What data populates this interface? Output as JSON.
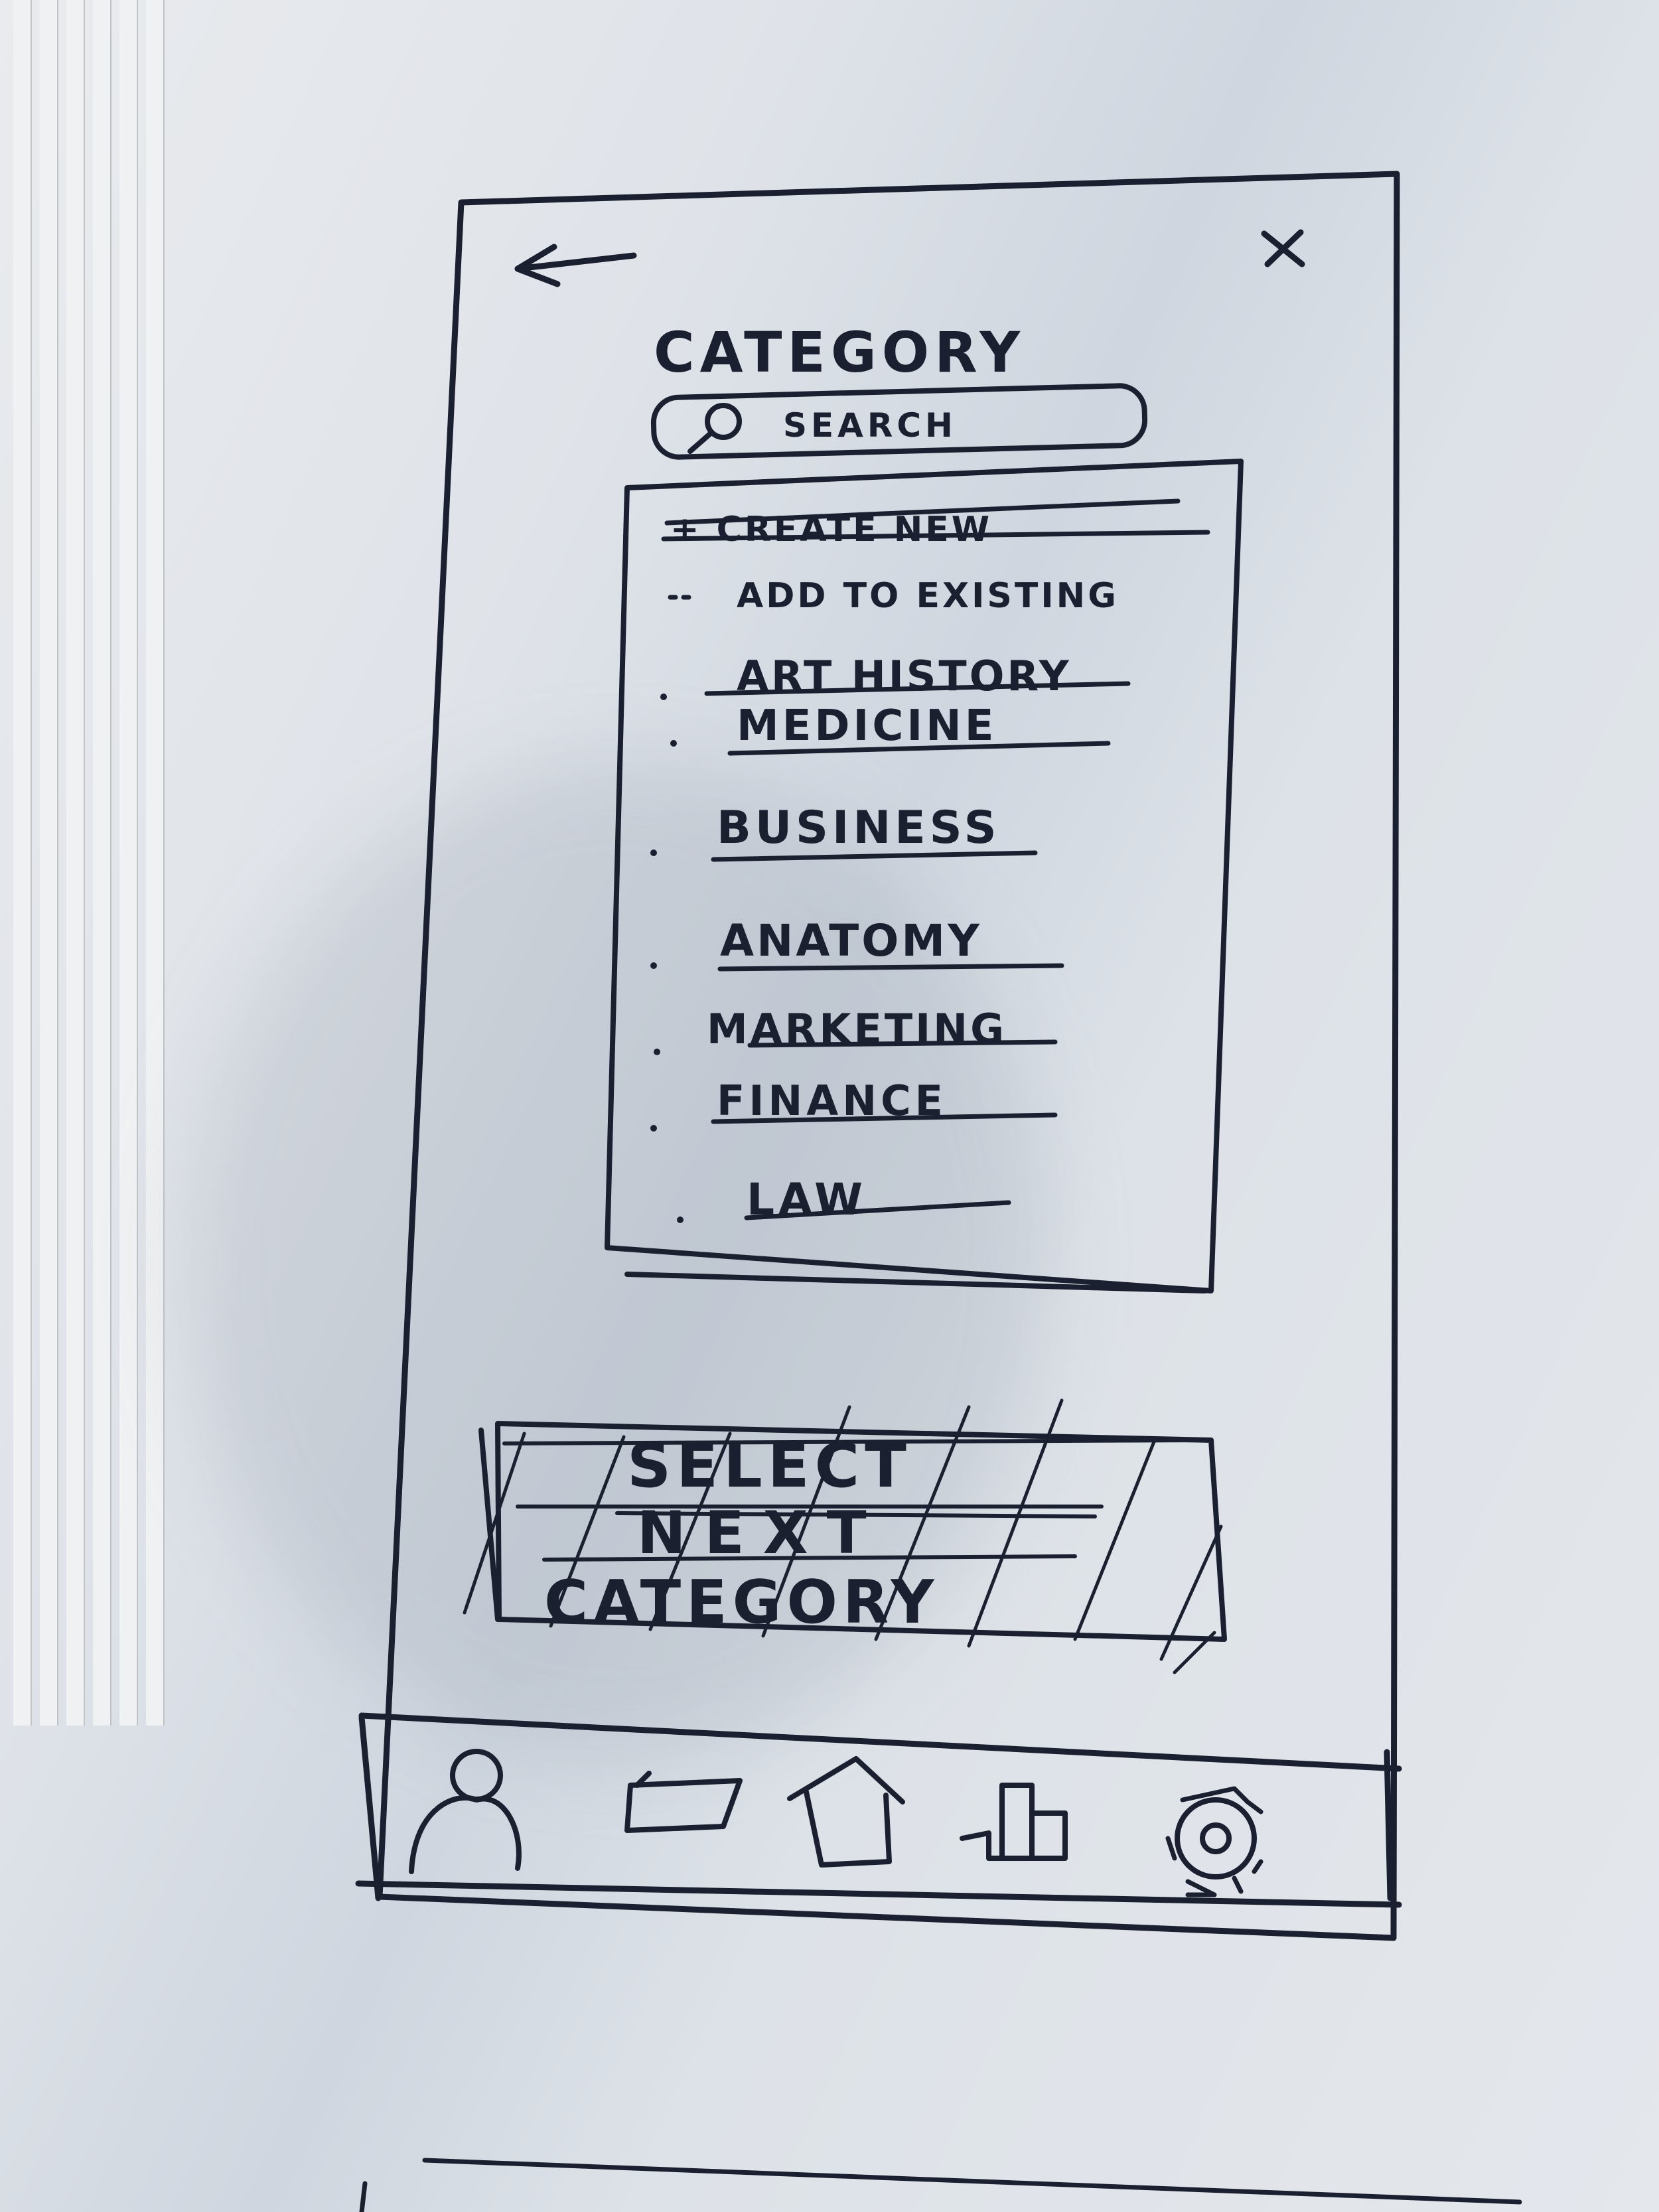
{
  "header": {
    "title": "CATEGORY"
  },
  "search": {
    "placeholder": "SEARCH"
  },
  "list": {
    "create_new": "+ CREATE NEW",
    "add_to_existing": "ADD TO EXISTING",
    "items": [
      {
        "label": "ART HISTORY"
      },
      {
        "label": "MEDICINE"
      },
      {
        "label": "BUSINESS"
      },
      {
        "label": "ANATOMY"
      },
      {
        "label": "MARKETING"
      },
      {
        "label": "FINANCE"
      },
      {
        "label": "LAW"
      }
    ]
  },
  "action": {
    "label_line1": "SELECT",
    "label_line2": "NEXT",
    "label_line3": "CATEGORY"
  },
  "bottom_nav": {
    "icons": [
      "profile-icon",
      "folder-icon",
      "home-icon",
      "stats-icon",
      "settings-icon"
    ]
  },
  "colors": {
    "ink": "#1b2030",
    "paper": "#e4e7ec"
  }
}
